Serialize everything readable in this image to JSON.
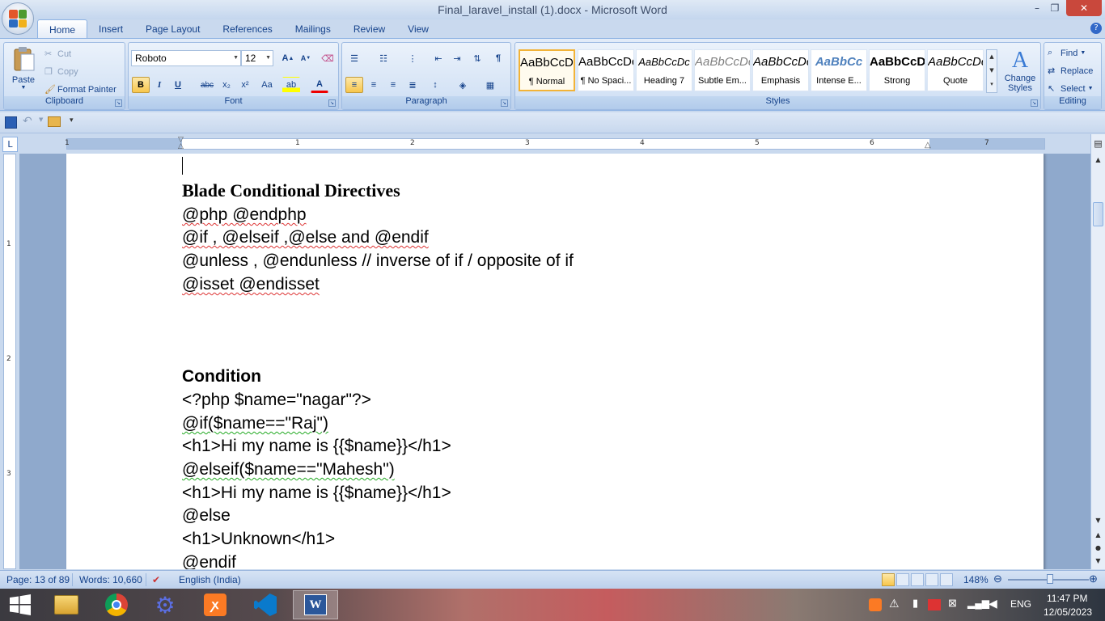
{
  "window": {
    "title": "Final_laravel_install (1).docx - Microsoft Word",
    "minimize": "–",
    "restore": "❐",
    "close": "✕"
  },
  "tabs": [
    "Home",
    "Insert",
    "Page Layout",
    "References",
    "Mailings",
    "Review",
    "View"
  ],
  "help": "?",
  "clipboard": {
    "label": "Clipboard",
    "paste": "Paste",
    "cut": "Cut",
    "copy": "Copy",
    "format_painter": "Format Painter"
  },
  "font": {
    "label": "Font",
    "family": "Roboto",
    "size": "12",
    "grow": "A",
    "shrink": "A",
    "bold": "B",
    "italic": "I",
    "underline": "U",
    "strike": "abc",
    "subscript": "x₂",
    "superscript": "x²",
    "change_case": "Aa",
    "highlight": "ab",
    "color": "A"
  },
  "paragraph": {
    "label": "Paragraph",
    "show_marks": "¶"
  },
  "styles": {
    "label": "Styles",
    "items": [
      {
        "sample": "AaBbCcDc",
        "name": "¶ Normal"
      },
      {
        "sample": "AaBbCcDc",
        "name": "¶ No Spaci..."
      },
      {
        "sample": "AaBbCcDc",
        "name": "Heading 7"
      },
      {
        "sample": "AaBbCcDc",
        "name": "Subtle Em..."
      },
      {
        "sample": "AaBbCcDc",
        "name": "Emphasis"
      },
      {
        "sample": "AaBbCc",
        "name": "Intense E..."
      },
      {
        "sample": "AaBbCcDc",
        "name": "Strong"
      },
      {
        "sample": "AaBbCcDc",
        "name": "Quote"
      }
    ],
    "change_styles": "Change Styles"
  },
  "editing": {
    "label": "Editing",
    "find": "Find",
    "replace": "Replace",
    "select": "Select"
  },
  "ruler": {
    "tab_selector": "L",
    "numbers": [
      "1",
      "1",
      "2",
      "3",
      "4",
      "5",
      "6",
      "7"
    ],
    "vnumbers": [
      "1",
      "2",
      "3"
    ]
  },
  "document": {
    "lines": [
      "Blade Conditional Directives",
      "@php @endphp",
      "@if , @elseif ,@else and @endif",
      "@unless , @endunless // inverse of if / opposite of if",
      "@isset @endisset",
      "Condition",
      "<?php $name=\"nagar\"?>",
      "@if($name==\"Raj\")",
      "<h1>Hi my name is {{$name}}</h1>",
      "@elseif($name==\"Mahesh\")",
      "<h1>Hi my name is {{$name}}</h1>",
      "@else",
      "<h1>Unknown</h1>",
      "@endif"
    ]
  },
  "status": {
    "page": "Page: 13 of 89",
    "words": "Words: 10,660",
    "language": "English (India)",
    "zoom": "148%"
  },
  "taskbar": {
    "language": "ENG",
    "time": "11:47 PM",
    "date": "12/05/2023"
  }
}
